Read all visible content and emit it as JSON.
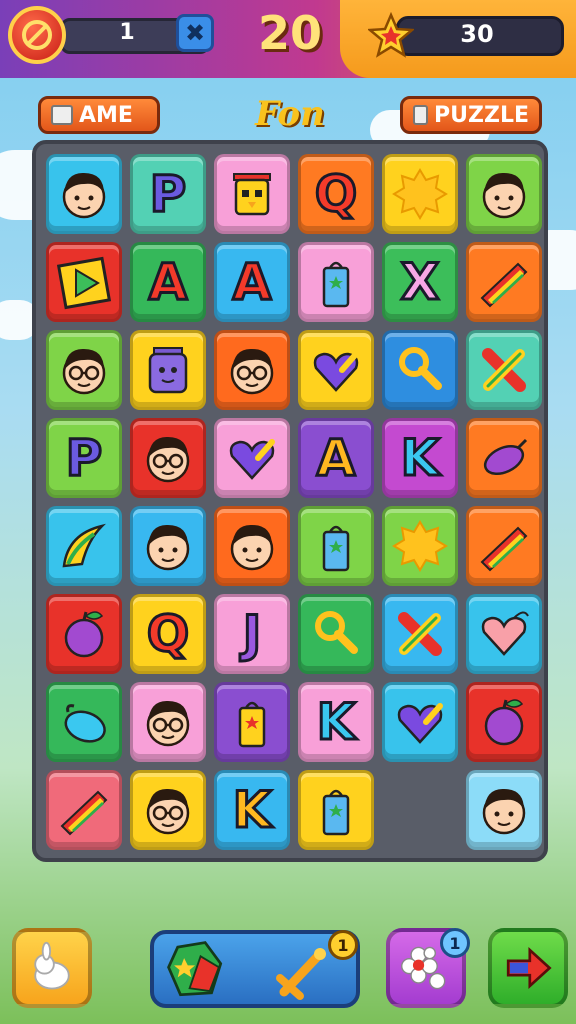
{
  "hud": {
    "moves": "1",
    "score": "20",
    "coins": "30",
    "shuffle_symbol": "✖"
  },
  "labels": {
    "left_pill": "AME",
    "title": "Fon",
    "right_pill": "PUZZLE"
  },
  "board": {
    "columns": 6,
    "rows": 8,
    "tiles": [
      {
        "bg": "#38c3ec",
        "icon": "face"
      },
      {
        "bg": "#53d1b4",
        "icon": "letter",
        "text": "P",
        "fg": "#6b5ae0"
      },
      {
        "bg": "#f8a0d8",
        "icon": "robot-yellow"
      },
      {
        "bg": "#ff7a22",
        "icon": "letter",
        "text": "Q",
        "fg": "#f43b2a"
      },
      {
        "bg": "#ffd21e",
        "icon": "sun"
      },
      {
        "bg": "#7fd448",
        "icon": "face"
      },
      {
        "bg": "#e8322a",
        "icon": "play"
      },
      {
        "bg": "#35b85a",
        "icon": "letter",
        "text": "A",
        "fg": "#f33a2a"
      },
      {
        "bg": "#38b8f0",
        "icon": "letter",
        "text": "A",
        "fg": "#f33a2a"
      },
      {
        "bg": "#f8a0d8",
        "icon": "bag-blue"
      },
      {
        "bg": "#3cbe5a",
        "icon": "letter",
        "text": "X",
        "fg": "#f8a8e6"
      },
      {
        "bg": "#ff7a22",
        "icon": "rainbow"
      },
      {
        "bg": "#7fd448",
        "icon": "face-glasses"
      },
      {
        "bg": "#ffd21e",
        "icon": "robot-purple"
      },
      {
        "bg": "#ff6a1e",
        "icon": "face-glasses"
      },
      {
        "bg": "#ffd21e",
        "icon": "heart-check"
      },
      {
        "bg": "#2e8ee0",
        "icon": "key"
      },
      {
        "bg": "#53d1b4",
        "icon": "cross-pencil"
      },
      {
        "bg": "#7fd448",
        "icon": "letter",
        "text": "P",
        "fg": "#6b5ae0"
      },
      {
        "bg": "#e8322a",
        "icon": "face-glasses"
      },
      {
        "bg": "#f8a0d8",
        "icon": "heart-check"
      },
      {
        "bg": "#8a4ed0",
        "icon": "letter",
        "text": "A",
        "fg": "#ffb820"
      },
      {
        "bg": "#c44ad0",
        "icon": "letter",
        "text": "K",
        "fg": "#3ac8f0"
      },
      {
        "bg": "#ff7a22",
        "icon": "plum"
      },
      {
        "bg": "#38c3ec",
        "icon": "banana"
      },
      {
        "bg": "#38b8f0",
        "icon": "face"
      },
      {
        "bg": "#ff6a1e",
        "icon": "face"
      },
      {
        "bg": "#7fd448",
        "icon": "bag-blue"
      },
      {
        "bg": "#7fd448",
        "icon": "sun"
      },
      {
        "bg": "#ff7a22",
        "icon": "rainbow"
      },
      {
        "bg": "#e8322a",
        "icon": "apple-purple"
      },
      {
        "bg": "#ffd21e",
        "icon": "letter",
        "text": "Q",
        "fg": "#f43b2a"
      },
      {
        "bg": "#f8a0d8",
        "icon": "letter",
        "text": "J",
        "fg": "#9a58e0"
      },
      {
        "bg": "#35b85a",
        "icon": "key"
      },
      {
        "bg": "#38b8f0",
        "icon": "cross-pencil"
      },
      {
        "bg": "#38c3ec",
        "icon": "heart-pink"
      },
      {
        "bg": "#35b85a",
        "icon": "plum-blue"
      },
      {
        "bg": "#f8a0d8",
        "icon": "face-glasses"
      },
      {
        "bg": "#8a4ed0",
        "icon": "bag-yellow"
      },
      {
        "bg": "#f8a0d8",
        "icon": "letter",
        "text": "K",
        "fg": "#3ac8f0"
      },
      {
        "bg": "#38c3ec",
        "icon": "heart-check"
      },
      {
        "bg": "#e8322a",
        "icon": "apple-purple"
      },
      {
        "bg": "#f06a7a",
        "icon": "rainbow"
      },
      {
        "bg": "#ffd21e",
        "icon": "face-glasses"
      },
      {
        "bg": "#38b8f0",
        "icon": "letter",
        "text": "K",
        "fg": "#ffb820"
      },
      {
        "bg": "#ffd21e",
        "icon": "bag-blue"
      },
      {
        "bg": null,
        "icon": "empty"
      },
      {
        "bg": "#8cdcf8",
        "icon": "face"
      }
    ]
  },
  "bottom": {
    "power_count": "1",
    "flower_count": "1"
  },
  "colors": {
    "board": "#595d68",
    "topbar_left": "#7a3fb8",
    "topbar_right": "#f59a1c"
  }
}
